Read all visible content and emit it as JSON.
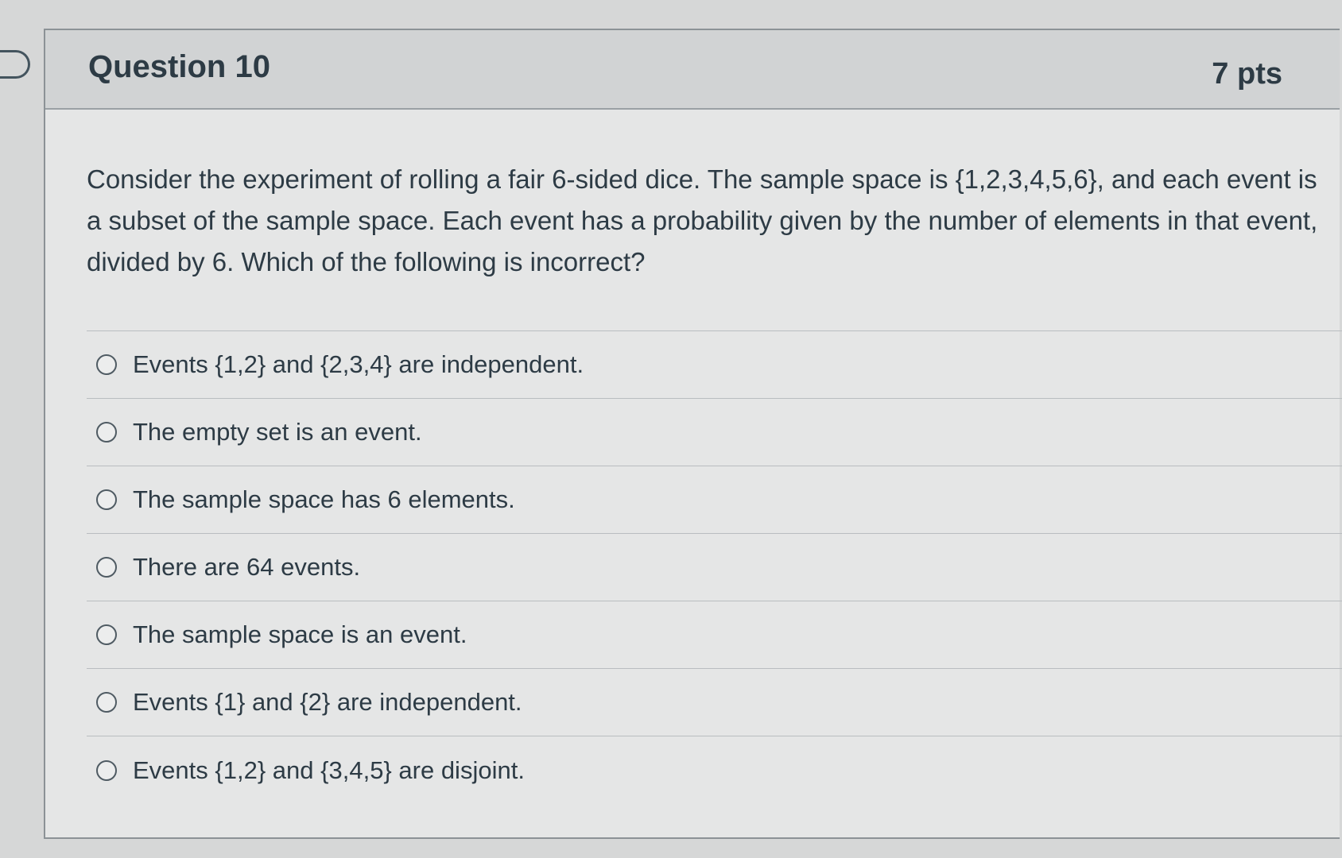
{
  "question": {
    "title": "Question 10",
    "points": "7 pts",
    "text": "Consider the experiment of rolling a fair 6-sided dice. The sample space is {1,2,3,4,5,6}, and each event is a subset of the sample space. Each event has a probability given by the number of elements in that event, divided by 6. Which of the following is incorrect?"
  },
  "answers": [
    {
      "label": "Events {1,2} and {2,3,4} are independent."
    },
    {
      "label": "The empty set is an event."
    },
    {
      "label": "The sample space has 6 elements."
    },
    {
      "label": "There are 64 events."
    },
    {
      "label": "The sample space is an event."
    },
    {
      "label": "Events {1} and {2} are independent."
    },
    {
      "label": "Events {1,2} and {3,4,5} are disjoint."
    }
  ],
  "icons": {
    "bookmark": "bookmark-flag-icon",
    "radio": "radio-button-icon"
  },
  "colors": {
    "text": "#2d3b45",
    "header_bg": "#d1d3d4",
    "card_bg": "#e5e6e6",
    "border": "#8c9296"
  }
}
